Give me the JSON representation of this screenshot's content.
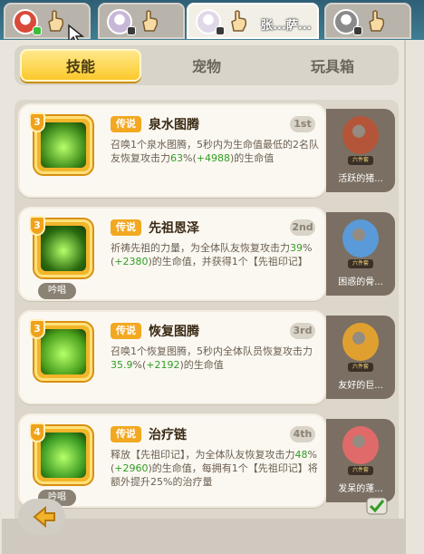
{
  "players": [
    {
      "name": "",
      "avatar_color": "#d94a3a",
      "badge": "green",
      "active": false
    },
    {
      "name": "",
      "avatar_color": "#c8b8d8",
      "badge": "dark",
      "active": false
    },
    {
      "name": "张...萨...",
      "avatar_color": "#e0d8e8",
      "badge": "dark",
      "active": true
    },
    {
      "name": "",
      "avatar_color": "#8a8a8a",
      "badge": "dark",
      "active": false
    }
  ],
  "tabs": [
    {
      "label": "技能",
      "active": true
    },
    {
      "label": "宠物",
      "active": false
    },
    {
      "label": "玩具箱",
      "active": false
    }
  ],
  "skills": [
    {
      "level": "3",
      "tag": "传说",
      "name": "泉水图腾",
      "order": "1st",
      "desc_pre": "召唤1个泉水图腾，5秒内为生命值最低的2名队友恢复攻击力",
      "desc_pct": "63",
      "desc_mid": "%(",
      "desc_val": "+4988",
      "desc_post": ")的生命值",
      "chant": "",
      "pet_name": "活跃的猪...",
      "pet_badge": "六件套",
      "icon_color": "#3d8a1a",
      "pet_color": "#b4553a"
    },
    {
      "level": "3",
      "tag": "传说",
      "name": "先祖恩泽",
      "order": "2nd",
      "desc_pre": "祈祷先祖的力量，为全体队友恢复攻击力",
      "desc_pct": "39",
      "desc_mid": "%(",
      "desc_val": "+2380",
      "desc_post": ")的生命值，并获得1个【先祖印记】",
      "chant": "吟唱",
      "pet_name": "困惑的骨...",
      "pet_badge": "六件套",
      "icon_color": "#2a6a10",
      "pet_color": "#5a9ad8"
    },
    {
      "level": "3",
      "tag": "传说",
      "name": "恢复图腾",
      "order": "3rd",
      "desc_pre": "召唤1个恢复图腾，5秒内全体队员恢复攻击力",
      "desc_pct": "35.9",
      "desc_mid": "%(",
      "desc_val": "+2192",
      "desc_post": ")的生命值",
      "chant": "",
      "pet_name": "友好的巨...",
      "pet_badge": "六件套",
      "icon_color": "#4aa01c",
      "pet_color": "#e0a030"
    },
    {
      "level": "4",
      "tag": "传说",
      "name": "治疗链",
      "order": "4th",
      "desc_pre": "释放【先祖印记】，为全体队友恢复攻击力",
      "desc_pct": "48",
      "desc_mid": "%(",
      "desc_val": "+2960",
      "desc_post": ")的生命值，每拥有1个【先祖印记】将额外提升25%的治疗量",
      "chant": "吟唱",
      "pet_name": "发呆的蓬...",
      "pet_badge": "六件套",
      "icon_color": "#3a9a22",
      "pet_color": "#e06a6a"
    }
  ],
  "colors": {
    "accent_yellow": "#fbc82c",
    "legend_orange": "#f2a821",
    "value_green": "#2f9e21"
  }
}
